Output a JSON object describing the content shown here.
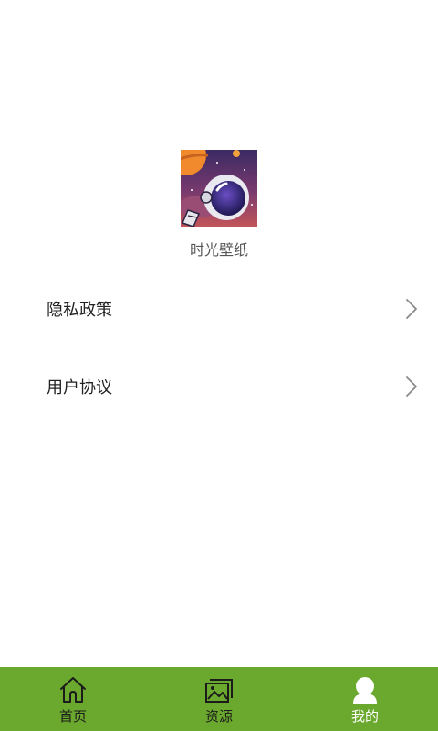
{
  "profile": {
    "app_name": "时光壁纸",
    "icon": "astronaut-app-icon"
  },
  "menu": [
    {
      "label": "隐私政策",
      "icon": "chevron-right-icon"
    },
    {
      "label": "用户协议",
      "icon": "chevron-right-icon"
    }
  ],
  "tabbar": {
    "background": "#6aa82e",
    "active_color": "#ffffff",
    "tabs": [
      {
        "label": "首页",
        "icon": "home-icon",
        "active": false
      },
      {
        "label": "资源",
        "icon": "gallery-icon",
        "active": false
      },
      {
        "label": "我的",
        "icon": "user-icon",
        "active": true
      }
    ]
  }
}
